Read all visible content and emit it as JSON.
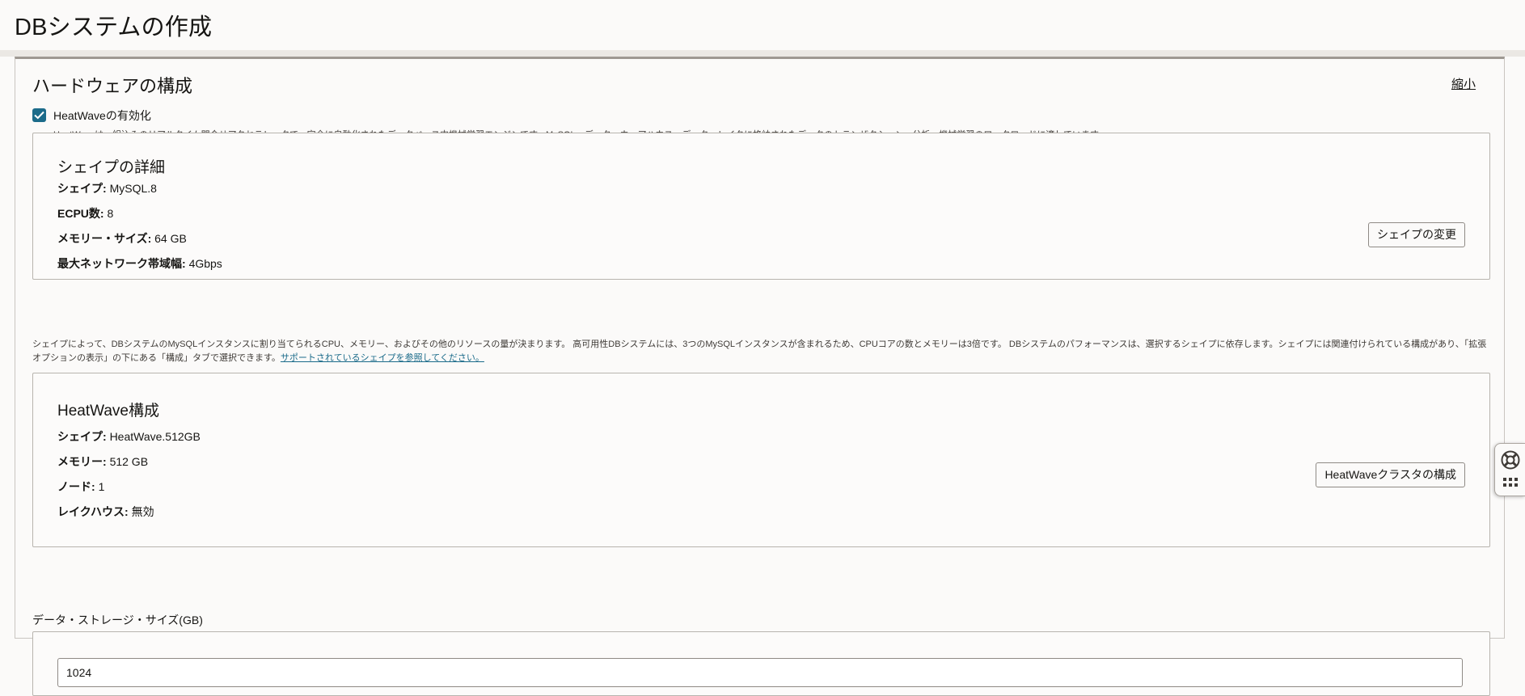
{
  "header": {
    "title": "DBシステムの作成"
  },
  "hardware": {
    "title": "ハードウェアの構成",
    "collapse_label": "縮小",
    "heatwave_checkbox": {
      "label": "HeatWaveの有効化",
      "checked": true,
      "help": "HeatWaveは、組込みのリアルタイム問合せアクセラレータで、完全に自動化されたデータベース内機械学習エンジンです。MySQL、データ・ウェアハウス、データ・レイクに格納されたデータのトランザクション、分析、機械学習のワークロードに適しています。"
    },
    "shape_card": {
      "title": "シェイプの詳細",
      "rows": [
        {
          "key": "シェイプ:",
          "value": "MySQL.8"
        },
        {
          "key": "ECPU数:",
          "value": "8"
        },
        {
          "key": "メモリー・サイズ:",
          "value": "64 GB"
        },
        {
          "key": "最大ネットワーク帯域幅:",
          "value": "4Gbps"
        }
      ],
      "button_label": "シェイプの変更"
    },
    "shape_description": "シェイプによって、DBシステムのMySQLインスタンスに割り当てられるCPU、メモリー、およびその他のリソースの量が決まります。 高可用性DBシステムには、3つのMySQLインスタンスが含まれるため、CPUコアの数とメモリーは3倍です。 DBシステムのパフォーマンスは、選択するシェイプに依存します。シェイプには関連付けられている構成があり、「拡張オプションの表示」の下にある「構成」タブで選択できます。",
    "shape_link": "サポートされているシェイプを参照してください。",
    "heatwave_card": {
      "title": "HeatWave構成",
      "rows": [
        {
          "key": "シェイプ:",
          "value": "HeatWave.512GB"
        },
        {
          "key": "メモリー:",
          "value": "512 GB"
        },
        {
          "key": "ノード:",
          "value": "1"
        },
        {
          "key": "レイクハウス:",
          "value": "無効"
        }
      ],
      "button_label": "HeatWaveクラスタの構成"
    },
    "storage": {
      "label": "データ・ストレージ・サイズ(GB)",
      "value": "1024"
    }
  },
  "help_widget": {
    "icon": "lifebuoy-icon",
    "grid_icon": "grid-dots-icon"
  },
  "colors": {
    "accent": "#1b6b8a",
    "border": "#b8b4ae",
    "background": "#fbfaf9"
  }
}
